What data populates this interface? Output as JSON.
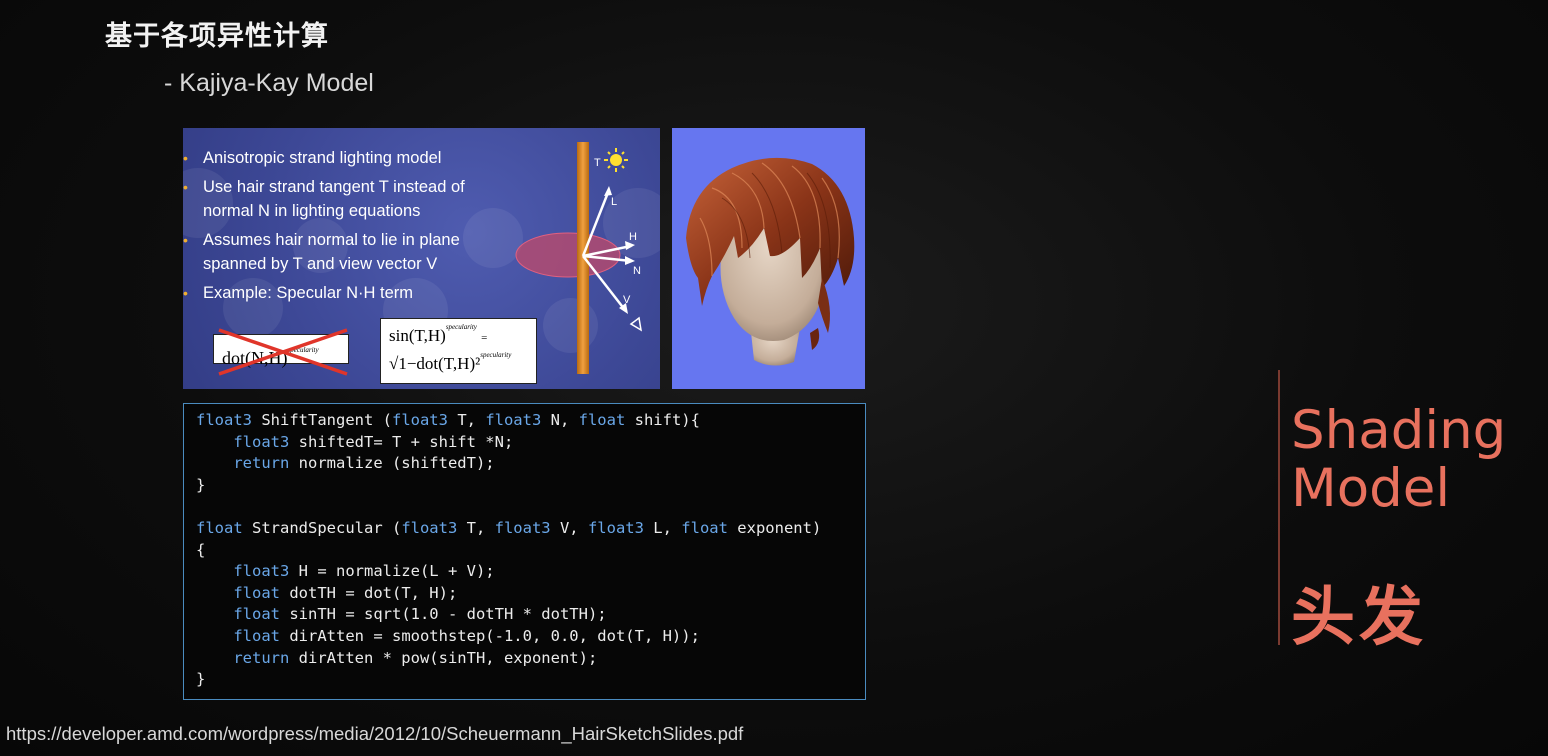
{
  "title": "基于各项异性计算",
  "subtitle": "- Kajiya-Kay Model",
  "slide": {
    "bullets": [
      "Anisotropic strand lighting model",
      "Use hair strand tangent T instead of normal N in lighting equations",
      "Assumes hair normal to lie in plane spanned by T and view vector V",
      "Example: Specular N·H term"
    ],
    "formula_dot": "dot(N,H)",
    "formula_dot_exp": "specularity",
    "formula_sin_top": "sin(T,H)",
    "formula_sin_eq": "=",
    "formula_sin_bottom": "√1−dot(T,H)²",
    "formula_sin_exp": "specularity",
    "diagram_labels": {
      "t": "T",
      "l": "L",
      "h": "H",
      "n": "N",
      "v": "V"
    }
  },
  "code": [
    [
      {
        "t": "float3",
        "c": "#6aa7e8"
      },
      {
        "t": " ShiftTangent (",
        "c": "#ececec"
      },
      {
        "t": "float3",
        "c": "#6aa7e8"
      },
      {
        "t": " T, ",
        "c": "#ececec"
      },
      {
        "t": "float3",
        "c": "#6aa7e8"
      },
      {
        "t": " N, ",
        "c": "#ececec"
      },
      {
        "t": "float",
        "c": "#6aa7e8"
      },
      {
        "t": " shift){",
        "c": "#ececec"
      }
    ],
    [
      {
        "t": "    float3",
        "c": "#6aa7e8"
      },
      {
        "t": " shiftedT= T + shift *N;",
        "c": "#ececec"
      }
    ],
    [
      {
        "t": "    return",
        "c": "#6aa7e8"
      },
      {
        "t": " normalize (shiftedT);",
        "c": "#ececec"
      }
    ],
    [
      {
        "t": "}",
        "c": "#ececec"
      }
    ],
    [
      {
        "t": "",
        "c": "#ececec"
      }
    ],
    [
      {
        "t": "float",
        "c": "#6aa7e8"
      },
      {
        "t": " StrandSpecular (",
        "c": "#ececec"
      },
      {
        "t": "float3",
        "c": "#6aa7e8"
      },
      {
        "t": " T, ",
        "c": "#ececec"
      },
      {
        "t": "float3",
        "c": "#6aa7e8"
      },
      {
        "t": " V, ",
        "c": "#ececec"
      },
      {
        "t": "float3",
        "c": "#6aa7e8"
      },
      {
        "t": " L, ",
        "c": "#ececec"
      },
      {
        "t": "float",
        "c": "#6aa7e8"
      },
      {
        "t": " exponent)",
        "c": "#ececec"
      }
    ],
    [
      {
        "t": "{",
        "c": "#ececec"
      }
    ],
    [
      {
        "t": "    float3",
        "c": "#6aa7e8"
      },
      {
        "t": " H = normalize(L + V);",
        "c": "#ececec"
      }
    ],
    [
      {
        "t": "    float",
        "c": "#6aa7e8"
      },
      {
        "t": " dotTH = dot(T, H);",
        "c": "#ececec"
      }
    ],
    [
      {
        "t": "    float",
        "c": "#6aa7e8"
      },
      {
        "t": " sinTH = sqrt(1.0 - dotTH * dotTH);",
        "c": "#ececec"
      }
    ],
    [
      {
        "t": "    float",
        "c": "#6aa7e8"
      },
      {
        "t": " dirAtten = smoothstep(-1.0, 0.0, dot(T, H));",
        "c": "#ececec"
      }
    ],
    [
      {
        "t": "    return",
        "c": "#6aa7e8"
      },
      {
        "t": " dirAtten * pow(sinTH, exponent);",
        "c": "#ececec"
      }
    ],
    [
      {
        "t": "}",
        "c": "#ececec"
      }
    ]
  ],
  "side": {
    "line1": "Shading",
    "line2": "Model",
    "cn": "头发"
  },
  "url": "https://developer.amd.com/wordpress/media/2012/10/Scheuermann_HairSketchSlides.pdf",
  "colors": {
    "accent": "#e8715e",
    "keyword": "#6aa7e8",
    "code_border": "#4a8bbf",
    "slide_bg": "#3d4896"
  }
}
